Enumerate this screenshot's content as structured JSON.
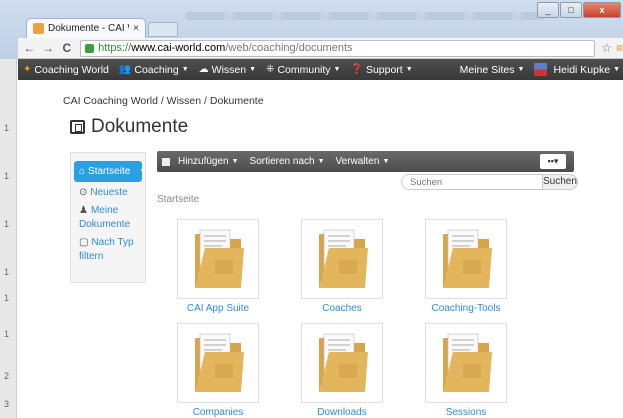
{
  "browser": {
    "tab_title": "Dokumente - CAI World",
    "tab_close": "×",
    "url_scheme": "https://",
    "url_host": "www.cai-world.com",
    "url_path": "/web/coaching/documents",
    "back": "←",
    "forward": "→",
    "reload": "C",
    "star": "☆",
    "menu": "≡",
    "minimize": "_",
    "maximize": "□",
    "close": "x",
    "gutter_numbers": [
      "1",
      "1",
      "1",
      "1",
      "1",
      "1",
      "2",
      "3"
    ]
  },
  "navbar": {
    "items": [
      {
        "label": "Coaching World",
        "caret": ""
      },
      {
        "label": "Coaching",
        "caret": "▼"
      },
      {
        "label": "Wissen",
        "caret": "▼"
      },
      {
        "label": "Community",
        "caret": "▼"
      },
      {
        "label": "Support",
        "caret": "▼"
      }
    ],
    "my_sites": "Meine Sites",
    "user": "Heidi Kupke",
    "caret": "▼"
  },
  "breadcrumb": "CAI Coaching World / Wissen / Dokumente",
  "page_title": "Dokumente",
  "sidebar": {
    "active": "Startseite",
    "active_caret": "▼",
    "items": [
      {
        "icon": "⊙",
        "label": "Neueste"
      },
      {
        "icon": "♟",
        "label": "Meine Dokumente"
      },
      {
        "icon": "▢",
        "label": "Nach Typ filtern"
      }
    ]
  },
  "doc_toolbar": {
    "items": [
      {
        "label": "Hinzufügen",
        "caret": "▼"
      },
      {
        "label": "Sortieren nach",
        "caret": "▼"
      },
      {
        "label": "Verwalten",
        "caret": "▼"
      }
    ],
    "view_button": "▪▪▾"
  },
  "search": {
    "placeholder": "Suchen",
    "button": "Suchen"
  },
  "folder_crumb": "Startseite",
  "folders": [
    "CAI App Suite",
    "Coaches",
    "Coaching-Tools",
    "Companies",
    "Downloads",
    "Sessions"
  ],
  "colors": {
    "accent": "#2aa0e3",
    "link": "#2b8ed8",
    "navbar": "#404040",
    "folder": "#e3b65e"
  }
}
